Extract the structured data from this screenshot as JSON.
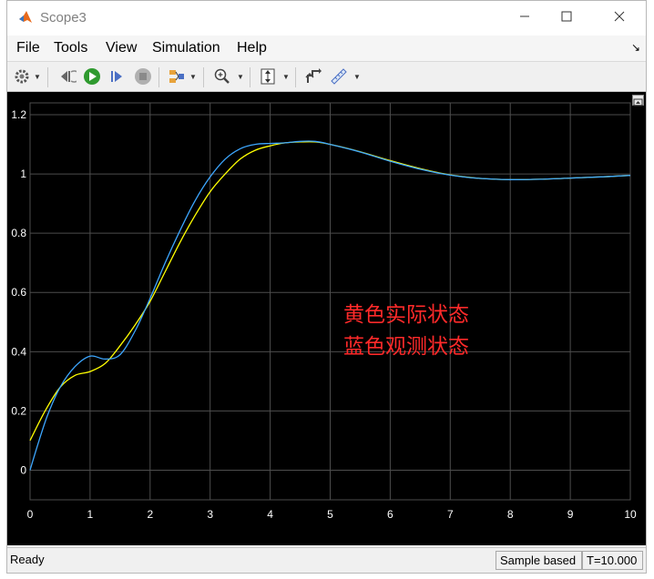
{
  "window": {
    "title": "Scope3",
    "minimize_icon": "minimize-icon",
    "maximize_icon": "maximize-icon",
    "close_icon": "close-icon"
  },
  "menu": {
    "items": [
      "File",
      "Tools",
      "View",
      "Simulation",
      "Help"
    ]
  },
  "toolbar": {
    "icons": [
      "gear-icon",
      "step-back-icon",
      "run-icon",
      "step-forward-icon",
      "stop-icon",
      "signal-select-icon",
      "zoom-icon",
      "autoscale-icon",
      "restore-icon",
      "measure-icon"
    ]
  },
  "status": {
    "text": "Ready",
    "sample": "Sample based",
    "time": "T=10.000"
  },
  "annotations": {
    "line1": "黄色实际状态",
    "line2": "蓝色观测状态",
    "color": "#ff2a2a"
  },
  "colors": {
    "background": "#000000",
    "grid": "#4d4d4d",
    "axis_text": "#ffffff",
    "yellow": "#ffff00",
    "blue": "#3da7ff"
  },
  "chart_data": {
    "type": "line",
    "xlim": [
      0,
      10
    ],
    "ylim": [
      -0.1,
      1.24
    ],
    "xticks": [
      0,
      1,
      2,
      3,
      4,
      5,
      6,
      7,
      8,
      9,
      10
    ],
    "yticks": [
      0,
      0.2,
      0.4,
      0.6,
      0.8,
      1,
      1.2
    ],
    "ytick_labels": [
      "0",
      "0.2",
      "0.4",
      "0.6",
      "0.8",
      "1",
      "1.2"
    ],
    "grid": true,
    "series": [
      {
        "color": "#ffff00",
        "x": [
          0,
          0.25,
          0.5,
          0.75,
          1,
          1.25,
          1.5,
          1.75,
          2,
          2.25,
          2.5,
          2.75,
          3,
          3.25,
          3.5,
          3.75,
          4,
          4.25,
          4.5,
          4.75,
          5,
          5.5,
          6,
          6.5,
          7,
          7.5,
          8,
          8.5,
          9,
          9.5,
          10
        ],
        "y": [
          0.1,
          0.2,
          0.28,
          0.32,
          0.333,
          0.36,
          0.42,
          0.49,
          0.57,
          0.67,
          0.77,
          0.86,
          0.94,
          1.0,
          1.05,
          1.08,
          1.095,
          1.105,
          1.108,
          1.108,
          1.1,
          1.075,
          1.045,
          1.018,
          0.997,
          0.985,
          0.981,
          0.982,
          0.986,
          0.99,
          0.995
        ]
      },
      {
        "color": "#3da7ff",
        "x": [
          0,
          0.15,
          0.3,
          0.5,
          0.75,
          1,
          1.25,
          1.5,
          1.75,
          2,
          2.25,
          2.5,
          2.75,
          3,
          3.25,
          3.5,
          3.75,
          4,
          4.25,
          4.5,
          4.75,
          5,
          5.5,
          6,
          6.5,
          7,
          7.5,
          8,
          8.5,
          9,
          9.5,
          10
        ],
        "y": [
          0,
          0.1,
          0.19,
          0.28,
          0.35,
          0.385,
          0.375,
          0.39,
          0.47,
          0.58,
          0.7,
          0.81,
          0.91,
          0.99,
          1.05,
          1.085,
          1.1,
          1.103,
          1.105,
          1.11,
          1.11,
          1.1,
          1.074,
          1.043,
          1.016,
          0.996,
          0.985,
          0.981,
          0.982,
          0.986,
          0.99,
          0.995
        ]
      }
    ]
  }
}
